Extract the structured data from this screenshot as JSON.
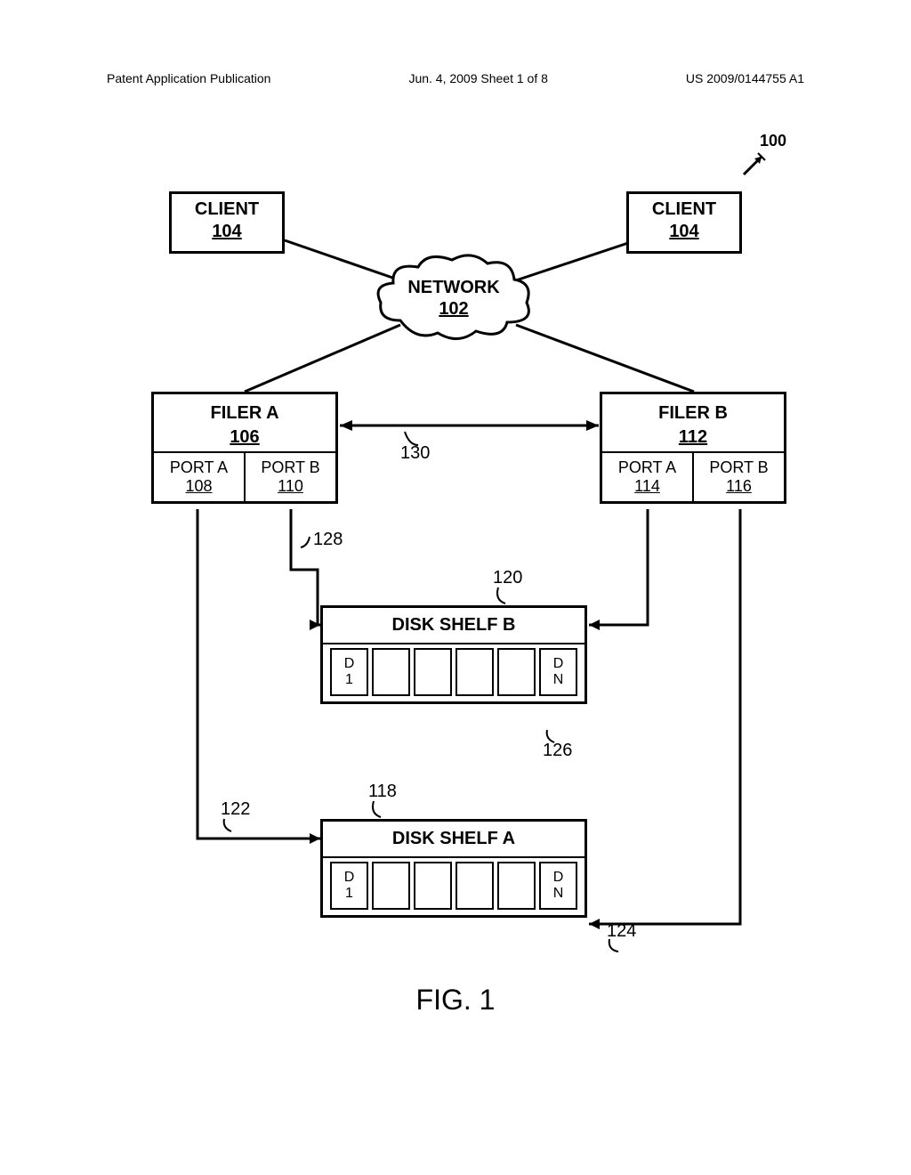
{
  "header": {
    "left": "Patent Application Publication",
    "center": "Jun. 4, 2009  Sheet 1 of 8",
    "right": "US 2009/0144755 A1"
  },
  "ref_top": "100",
  "client_a": {
    "title": "CLIENT",
    "num": "104"
  },
  "client_b": {
    "title": "CLIENT",
    "num": "104"
  },
  "network": {
    "title": "NETWORK",
    "num": "102"
  },
  "filer_a": {
    "title": "FILER A",
    "num": "106",
    "port_a": {
      "label": "PORT A",
      "num": "108"
    },
    "port_b": {
      "label": "PORT B",
      "num": "110"
    }
  },
  "filer_b": {
    "title": "FILER B",
    "num": "112",
    "port_a": {
      "label": "PORT A",
      "num": "114"
    },
    "port_b": {
      "label": "PORT B",
      "num": "116"
    }
  },
  "shelf_b": {
    "title": "DISK SHELF B",
    "disk1_a": "D",
    "disk1_b": "1",
    "diskN_a": "D",
    "diskN_b": "N"
  },
  "shelf_a": {
    "title": "DISK SHELF A",
    "disk1_a": "D",
    "disk1_b": "1",
    "diskN_a": "D",
    "diskN_b": "N"
  },
  "annot": {
    "n130": "130",
    "n128": "128",
    "n120": "120",
    "n126": "126",
    "n118": "118",
    "n122": "122",
    "n124": "124"
  },
  "fig": "FIG. 1"
}
